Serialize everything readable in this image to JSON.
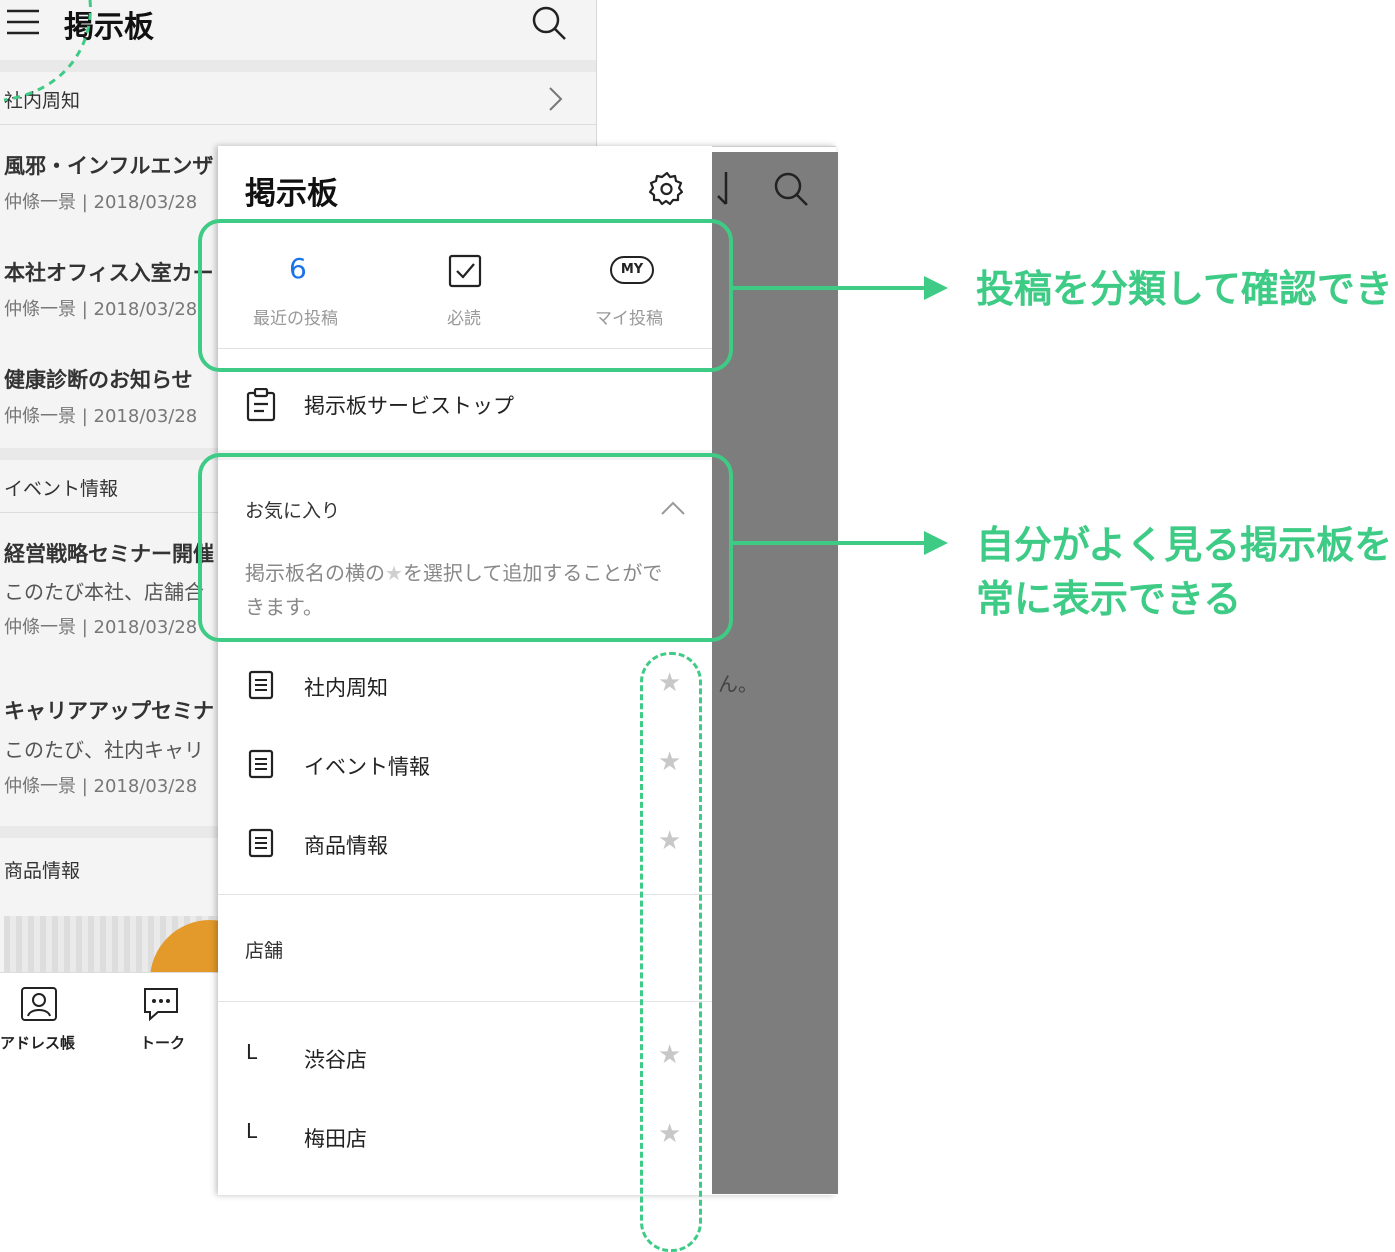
{
  "background_app": {
    "title": "掲示板",
    "sections": [
      {
        "label": "社内周知"
      },
      {
        "label": "イベント情報"
      },
      {
        "label": "商品情報"
      }
    ],
    "posts": [
      {
        "title": "風邪・インフルエンザ",
        "meta": "仲條一景 | 2018/03/28"
      },
      {
        "title": "本社オフィス入室カー",
        "meta": "仲條一景 | 2018/03/28"
      },
      {
        "title": "健康診断のお知らせ",
        "meta": "仲條一景 | 2018/03/28"
      },
      {
        "title": "経営戦略セミナー開催",
        "body": "このたび本社、店舗合",
        "meta": "仲條一景 | 2018/03/28"
      },
      {
        "title": "キャリアアップセミナ",
        "body": "このたび、社内キャリ",
        "meta": "仲條一景 | 2018/03/28"
      }
    ],
    "tabbar": [
      {
        "label": "アドレス帳",
        "icon": "address-book-icon"
      },
      {
        "label": "トーク",
        "icon": "chat-icon"
      }
    ],
    "dim_hint_fragment": "ん。"
  },
  "drawer": {
    "title": "掲示板",
    "summary": [
      {
        "value": "6",
        "label": "最近の投稿"
      },
      {
        "icon": "checkbox-icon",
        "label": "必読"
      },
      {
        "icon": "my-badge-icon",
        "badge_text": "MY",
        "label": "マイ投稿"
      }
    ],
    "service_top_label": "掲示板サービストップ",
    "favorites_label": "お気に入り",
    "favorites_hint_before": "掲示板名の横の",
    "favorites_hint_after": "を選択して追加することができます。",
    "boards": [
      {
        "label": "社内周知"
      },
      {
        "label": "イベント情報"
      },
      {
        "label": "商品情報"
      }
    ],
    "store_label": "店舗",
    "stores": [
      {
        "label": "渋谷店"
      },
      {
        "label": "梅田店"
      }
    ],
    "store_prefix": "L"
  },
  "annotations": {
    "callout_1": "投稿を分類して確認でき",
    "callout_2_line1": "自分がよく見る掲示板を",
    "callout_2_line2": "常に表示できる",
    "accent_color": "#3ecb85"
  }
}
